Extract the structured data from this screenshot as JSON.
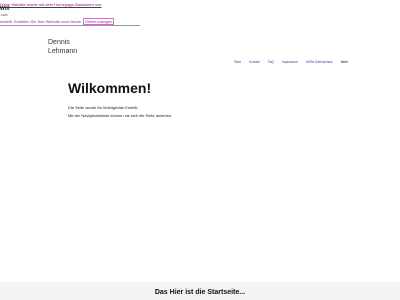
{
  "wix_banner": {
    "line1": "Diese Website wurde mit dem Homepage-Baukasten von",
    "logo": "WiX",
    "com": ".com",
    "line2": "erstellt. Erstellen Sie Ihre Website noch heute.",
    "cta": "Gleich loslegen"
  },
  "site": {
    "name_line1": "Dennis",
    "name_line2": "Lehmann"
  },
  "nav": {
    "items": [
      {
        "label": "Start"
      },
      {
        "label": "Kontakt"
      },
      {
        "label": "FaQ"
      },
      {
        "label": "Impressum"
      },
      {
        "label": "AGBs Datenschutz"
      },
      {
        "label": "Mehr"
      }
    ]
  },
  "main": {
    "heading": "Wilkommen!",
    "para1": "Die Seite wurde für Mobilgeräte Erstellt.",
    "para2": "Mit der Navigtionsleiste können sie sich die Seite ansehen."
  },
  "footer": {
    "title": "Das Hier ist die Startseite..."
  }
}
